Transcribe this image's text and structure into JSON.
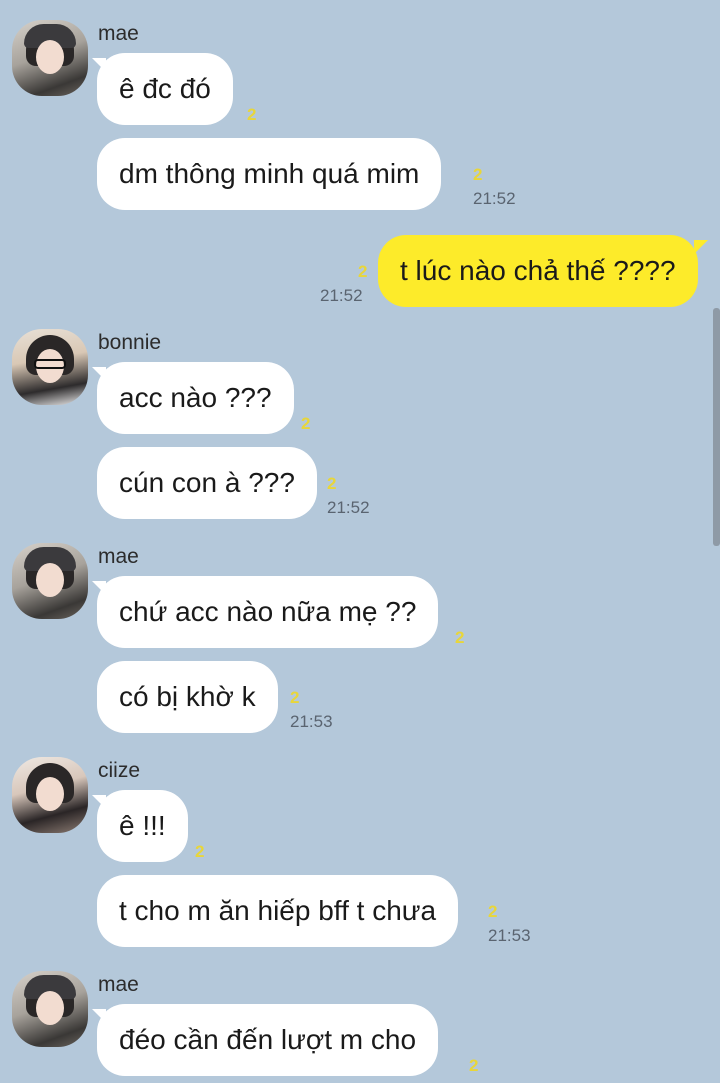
{
  "colors": {
    "background": "#b4c8da",
    "incoming_bubble": "#ffffff",
    "outgoing_bubble": "#fdeb2a",
    "unread_count": "#e8d63a",
    "timestamp": "#5a6470"
  },
  "messages": [
    {
      "sender": "mae",
      "text": "ê đc đó",
      "unread": "2",
      "time": ""
    },
    {
      "sender": "mae",
      "text": "dm thông minh quá mim",
      "unread": "2",
      "time": "21:52"
    },
    {
      "sender": "me",
      "text": "t lúc nào chả thế ????",
      "unread": "2",
      "time": "21:52"
    },
    {
      "sender": "bonnie",
      "text": "acc nào ???",
      "unread": "2",
      "time": ""
    },
    {
      "sender": "bonnie",
      "text": "cún con à ???",
      "unread": "2",
      "time": "21:52"
    },
    {
      "sender": "mae",
      "text": "chứ acc nào nữa mẹ ??",
      "unread": "2",
      "time": ""
    },
    {
      "sender": "mae",
      "text": "có bị khờ k",
      "unread": "2",
      "time": "21:53"
    },
    {
      "sender": "ciize",
      "text": "ê !!!",
      "unread": "2",
      "time": ""
    },
    {
      "sender": "ciize",
      "text": "t cho m ăn hiếp bff t chưa",
      "unread": "2",
      "time": "21:53"
    },
    {
      "sender": "mae",
      "text": "đéo cần đến lượt m cho",
      "unread": "2",
      "time": ""
    }
  ]
}
